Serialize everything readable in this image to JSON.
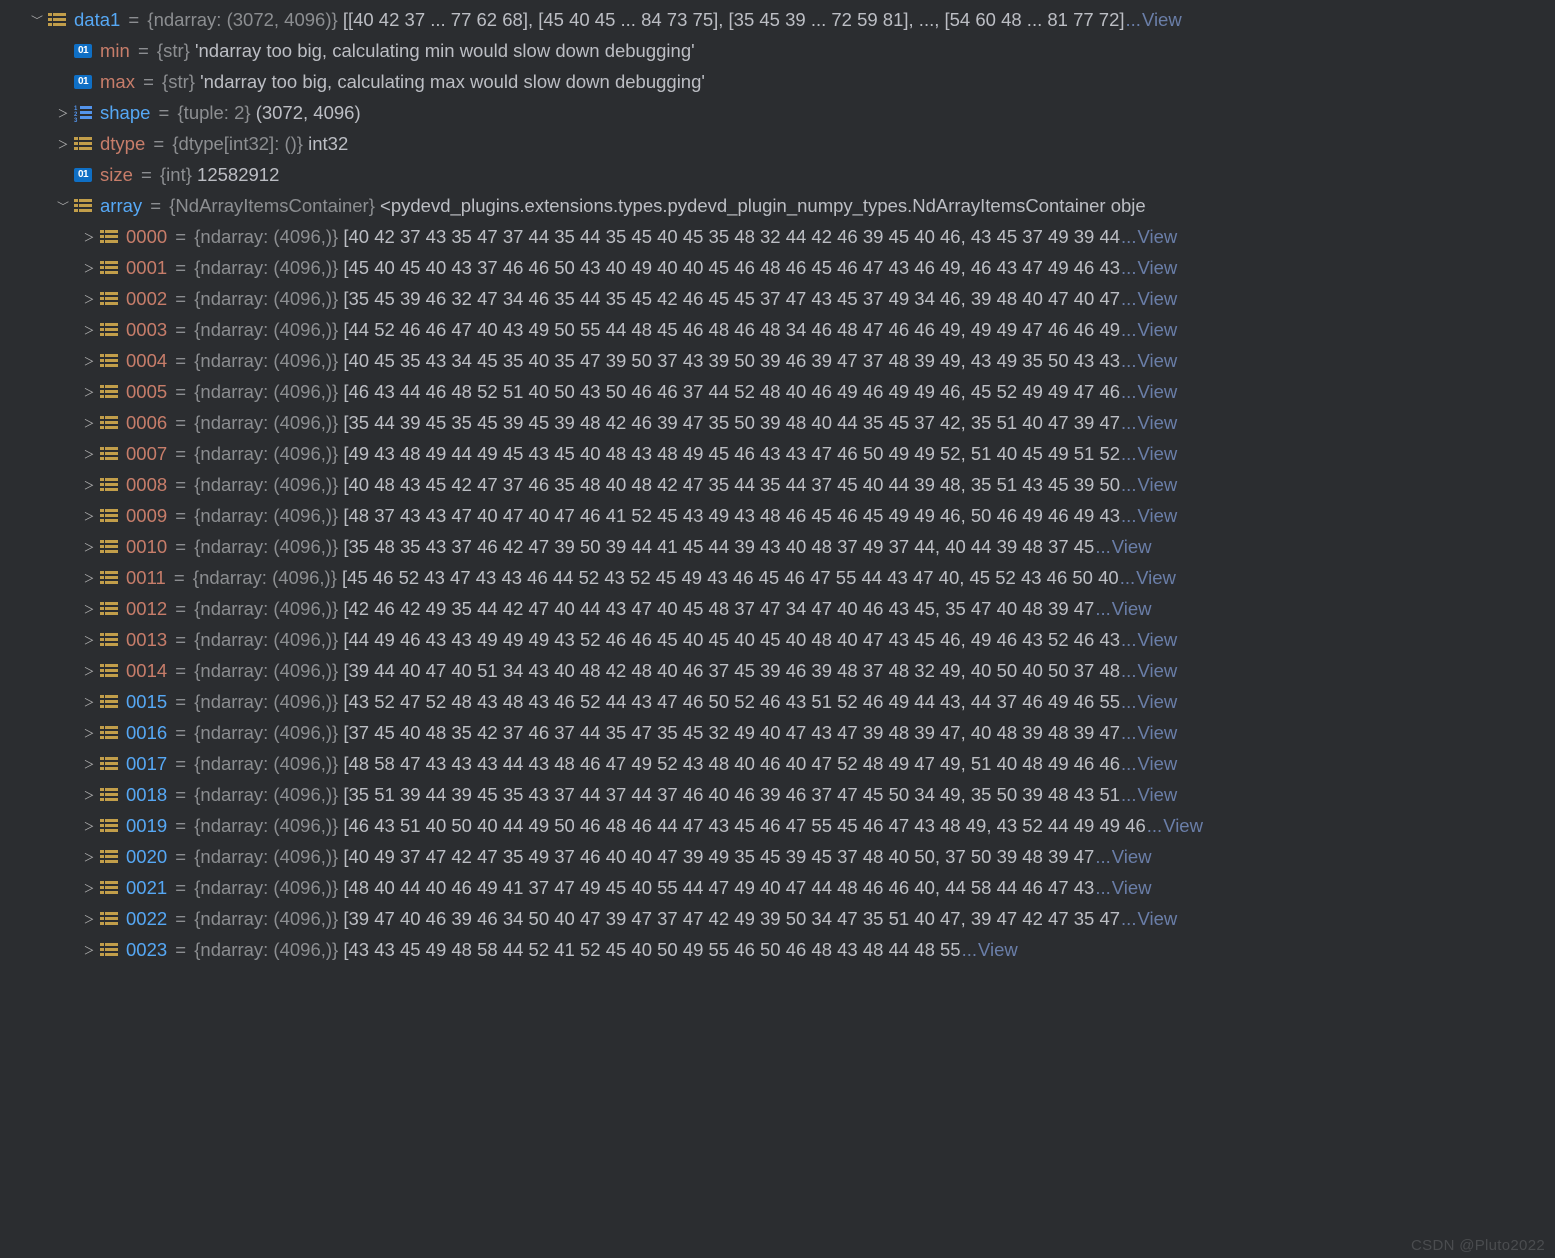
{
  "indent_unit": 26,
  "watermark": "CSDN @Pluto2022",
  "link_ellipsis": "...",
  "link_view": "View",
  "root": {
    "key": "data1",
    "key_color": "blue",
    "expanded": true,
    "icon": "array",
    "type": "{ndarray: (3072, 4096)}",
    "value": "[[40 42 37 ... 77 62 68], [45 40 45 ... 84 73 75], [35 45 39 ... 72 59 81], ..., [54 60 48 ... 81 77 72]",
    "has_view": true,
    "children": [
      {
        "key": "min",
        "key_color": "red",
        "icon": "str",
        "type": "{str}",
        "value": "'ndarray too big, calculating min would slow down debugging'"
      },
      {
        "key": "max",
        "key_color": "red",
        "icon": "str",
        "type": "{str}",
        "value": "'ndarray too big, calculating max would slow down debugging'"
      },
      {
        "key": "shape",
        "key_color": "blue",
        "icon": "tuple",
        "type": "{tuple: 2}",
        "value": "(3072, 4096)",
        "expandable": true
      },
      {
        "key": "dtype",
        "key_color": "red",
        "icon": "array",
        "type": "{dtype[int32]: ()}",
        "value": "int32",
        "expandable": true
      },
      {
        "key": "size",
        "key_color": "red",
        "icon": "str",
        "type": "{int}",
        "value": "12582912"
      },
      {
        "key": "array",
        "key_color": "blue",
        "icon": "array",
        "expanded": true,
        "type": "{NdArrayItemsContainer}",
        "value": "<pydevd_plugins.extensions.types.pydevd_plugin_numpy_types.NdArrayItemsContainer obje",
        "children": [
          {
            "key": "0000",
            "key_color": "red",
            "icon": "array",
            "type": "{ndarray: (4096,)}",
            "value": "[40 42 37 43 35 47 37 44 35 44 35 45 40 45 35 48 32 44 42 46 39 45 40 46, 43 45 37 49 39 44",
            "expandable": true,
            "has_view": true
          },
          {
            "key": "0001",
            "key_color": "red",
            "icon": "array",
            "type": "{ndarray: (4096,)}",
            "value": "[45 40 45 40 43 37 46 46 50 43 40 49 40 40 45 46 48 46 45 46 47 43 46 49, 46 43 47 49 46 43",
            "expandable": true,
            "has_view": true
          },
          {
            "key": "0002",
            "key_color": "red",
            "icon": "array",
            "type": "{ndarray: (4096,)}",
            "value": "[35 45 39 46 32 47 34 46 35 44 35 45 42 46 45 45 37 47 43 45 37 49 34 46, 39 48 40 47 40 47",
            "expandable": true,
            "has_view": true
          },
          {
            "key": "0003",
            "key_color": "red",
            "icon": "array",
            "type": "{ndarray: (4096,)}",
            "value": "[44 52 46 46 47 40 43 49 50 55 44 48 45 46 48 46 48 34 46 48 47 46 46 49, 49 49 47 46 46 49",
            "expandable": true,
            "has_view": true
          },
          {
            "key": "0004",
            "key_color": "red",
            "icon": "array",
            "type": "{ndarray: (4096,)}",
            "value": "[40 45 35 43 34 45 35 40 35 47 39 50 37 43 39 50 39 46 39 47 37 48 39 49, 43 49 35 50 43 43",
            "expandable": true,
            "has_view": true
          },
          {
            "key": "0005",
            "key_color": "red",
            "icon": "array",
            "type": "{ndarray: (4096,)}",
            "value": "[46 43 44 46 48 52 51 40 50 43 50 46 46 37 44 52 48 40 46 49 46 49 49 46, 45 52 49 49 47 46",
            "expandable": true,
            "has_view": true
          },
          {
            "key": "0006",
            "key_color": "red",
            "icon": "array",
            "type": "{ndarray: (4096,)}",
            "value": "[35 44 39 45 35 45 39 45 39 48 42 46 39 47 35 50 39 48 40 44 35 45 37 42, 35 51 40 47 39 47",
            "expandable": true,
            "has_view": true
          },
          {
            "key": "0007",
            "key_color": "red",
            "icon": "array",
            "type": "{ndarray: (4096,)}",
            "value": "[49 43 48 49 44 49 45 43 45 40 48 43 48 49 45 46 43 43 47 46 50 49 49 52, 51 40 45 49 51 52",
            "expandable": true,
            "has_view": true
          },
          {
            "key": "0008",
            "key_color": "red",
            "icon": "array",
            "type": "{ndarray: (4096,)}",
            "value": "[40 48 43 45 42 47 37 46 35 48 40 48 42 47 35 44 35 44 37 45 40 44 39 48, 35 51 43 45 39 50",
            "expandable": true,
            "has_view": true
          },
          {
            "key": "0009",
            "key_color": "red",
            "icon": "array",
            "type": "{ndarray: (4096,)}",
            "value": "[48 37 43 43 47 40 47 40 47 46 41 52 45 43 49 43 48 46 45 46 45 49 49 46, 50 46 49 46 49 43",
            "expandable": true,
            "has_view": true
          },
          {
            "key": "0010",
            "key_color": "red",
            "icon": "array",
            "type": "{ndarray: (4096,)}",
            "value": "[35 48 35 43 37 46 42 47 39 50 39 44 41 45 44 39 43 40 48 37 49 37 44, 40 44 39 48 37 45",
            "expandable": true,
            "has_view": true
          },
          {
            "key": "0011",
            "key_color": "red",
            "icon": "array",
            "type": "{ndarray: (4096,)}",
            "value": "[45 46 52 43 47 43 43 46 44 52 43 52 45 49 43 46 45 46 47 55 44 43 47 40, 45 52 43 46 50 40",
            "expandable": true,
            "has_view": true
          },
          {
            "key": "0012",
            "key_color": "red",
            "icon": "array",
            "type": "{ndarray: (4096,)}",
            "value": "[42 46 42 49 35 44 42 47 40 44 43 47 40 45 48 37 47 34 47 40 46 43 45, 35 47 40 48 39 47",
            "expandable": true,
            "has_view": true
          },
          {
            "key": "0013",
            "key_color": "red",
            "icon": "array",
            "type": "{ndarray: (4096,)}",
            "value": "[44 49 46 43 43 49 49 49 43 52 46 46 45 40 45 40 45 40 48 40 47 43 45 46, 49 46 43 52 46 43",
            "expandable": true,
            "has_view": true
          },
          {
            "key": "0014",
            "key_color": "red",
            "icon": "array",
            "type": "{ndarray: (4096,)}",
            "value": "[39 44 40 47 40 51 34 43 40 48 42 48 40 46 37 45 39 46 39 48 37 48 32 49, 40 50 40 50 37 48",
            "expandable": true,
            "has_view": true
          },
          {
            "key": "0015",
            "key_color": "blue",
            "icon": "array",
            "type": "{ndarray: (4096,)}",
            "value": "[43 52 47 52 48 43 48 43 46 52 44 43 47 46 50 52 46 43 51 52 46 49 44 43, 44 37 46 49 46 55",
            "expandable": true,
            "has_view": true
          },
          {
            "key": "0016",
            "key_color": "blue",
            "icon": "array",
            "type": "{ndarray: (4096,)}",
            "value": "[37 45 40 48 35 42 37 46 37 44 35 47 35 45 32 49 40 47 43 47 39 48 39 47, 40 48 39 48 39 47",
            "expandable": true,
            "has_view": true
          },
          {
            "key": "0017",
            "key_color": "blue",
            "icon": "array",
            "type": "{ndarray: (4096,)}",
            "value": "[48 58 47 43 43 43 44 43 48 46 47 49 52 43 48 40 46 40 47 52 48 49 47 49, 51 40 48 49 46 46",
            "expandable": true,
            "has_view": true
          },
          {
            "key": "0018",
            "key_color": "blue",
            "icon": "array",
            "type": "{ndarray: (4096,)}",
            "value": "[35 51 39 44 39 45 35 43 37 44 37 44 37 46 40 46 39 46 37 47 45 50 34 49, 35 50 39 48 43 51",
            "expandable": true,
            "has_view": true
          },
          {
            "key": "0019",
            "key_color": "blue",
            "icon": "array",
            "type": "{ndarray: (4096,)}",
            "value": "[46 43 51 40 50 40 44 49 50 46 48 46 44 47 43 45 46 47 55 45 46 47 43 48 49, 43 52 44 49 49 46",
            "expandable": true,
            "has_view": true
          },
          {
            "key": "0020",
            "key_color": "blue",
            "icon": "array",
            "type": "{ndarray: (4096,)}",
            "value": "[40 49 37 47 42 47 35 49 37 46 40 40 47 39 49 35 45 39 45 37 48 40 50, 37 50 39 48 39 47",
            "expandable": true,
            "has_view": true
          },
          {
            "key": "0021",
            "key_color": "blue",
            "icon": "array",
            "type": "{ndarray: (4096,)}",
            "value": "[48 40 44 40 46 49 41 37 47 49 45 40 55 44 47 49 40 47 44 48 46 46 40, 44 58 44 46 47 43",
            "expandable": true,
            "has_view": true
          },
          {
            "key": "0022",
            "key_color": "blue",
            "icon": "array",
            "type": "{ndarray: (4096,)}",
            "value": "[39 47 40 46 39 46 34 50 40 47 39 47 37 47 42 49 39 50 34 47 35 51 40 47, 39 47 42 47 35 47",
            "expandable": true,
            "has_view": true
          },
          {
            "key": "0023",
            "key_color": "blue",
            "icon": "array",
            "type": "{ndarray: (4096,)}",
            "value": "[43 43 45 49 48 58 44 52 41 52 45 40 50 49 55 46 50 46 48 43 48 44 48 55",
            "expandable": true,
            "has_view": true
          }
        ]
      }
    ]
  }
}
